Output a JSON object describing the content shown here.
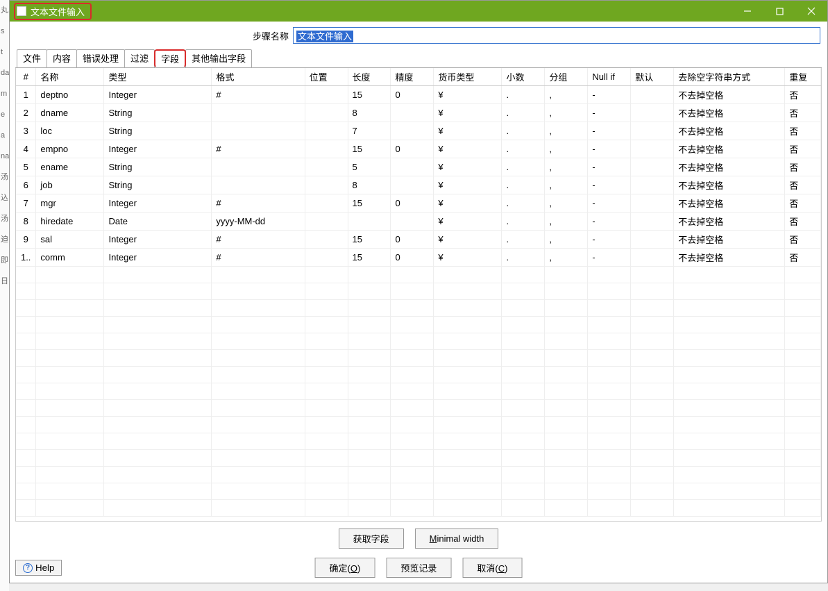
{
  "window": {
    "title": "文本文件输入"
  },
  "step": {
    "label": "步骤名称",
    "value": "文本文件输入"
  },
  "tabs": [
    "文件",
    "内容",
    "错误处理",
    "过滤",
    "字段",
    "其他输出字段"
  ],
  "active_tab_index": 4,
  "highlight_tab_index": 4,
  "columns": [
    "#",
    "名称",
    "类型",
    "格式",
    "位置",
    "长度",
    "精度",
    "货币类型",
    "小数",
    "分组",
    "Null if",
    "默认",
    "去除空字符串方式",
    "重复"
  ],
  "rows": [
    {
      "idx": "1",
      "name": "deptno",
      "type": "Integer",
      "format": "#",
      "pos": "",
      "len": "15",
      "prec": "0",
      "curr": "¥",
      "dec": ".",
      "grp": ",",
      "nullif": "-",
      "def": "",
      "trim": "不去掉空格",
      "rep": "否"
    },
    {
      "idx": "2",
      "name": "dname",
      "type": "String",
      "format": "",
      "pos": "",
      "len": "8",
      "prec": "",
      "curr": "¥",
      "dec": ".",
      "grp": ",",
      "nullif": "-",
      "def": "",
      "trim": "不去掉空格",
      "rep": "否"
    },
    {
      "idx": "3",
      "name": "loc",
      "type": "String",
      "format": "",
      "pos": "",
      "len": "7",
      "prec": "",
      "curr": "¥",
      "dec": ".",
      "grp": ",",
      "nullif": "-",
      "def": "",
      "trim": "不去掉空格",
      "rep": "否"
    },
    {
      "idx": "4",
      "name": "empno",
      "type": "Integer",
      "format": "#",
      "pos": "",
      "len": "15",
      "prec": "0",
      "curr": "¥",
      "dec": ".",
      "grp": ",",
      "nullif": "-",
      "def": "",
      "trim": "不去掉空格",
      "rep": "否"
    },
    {
      "idx": "5",
      "name": "ename",
      "type": "String",
      "format": "",
      "pos": "",
      "len": "5",
      "prec": "",
      "curr": "¥",
      "dec": ".",
      "grp": ",",
      "nullif": "-",
      "def": "",
      "trim": "不去掉空格",
      "rep": "否"
    },
    {
      "idx": "6",
      "name": "job",
      "type": "String",
      "format": "",
      "pos": "",
      "len": "8",
      "prec": "",
      "curr": "¥",
      "dec": ".",
      "grp": ",",
      "nullif": "-",
      "def": "",
      "trim": "不去掉空格",
      "rep": "否"
    },
    {
      "idx": "7",
      "name": "mgr",
      "type": "Integer",
      "format": "#",
      "pos": "",
      "len": "15",
      "prec": "0",
      "curr": "¥",
      "dec": ".",
      "grp": ",",
      "nullif": "-",
      "def": "",
      "trim": "不去掉空格",
      "rep": "否"
    },
    {
      "idx": "8",
      "name": "hiredate",
      "type": "Date",
      "format": "yyyy-MM-dd",
      "pos": "",
      "len": "",
      "prec": "",
      "curr": "¥",
      "dec": ".",
      "grp": ",",
      "nullif": "-",
      "def": "",
      "trim": "不去掉空格",
      "rep": "否"
    },
    {
      "idx": "9",
      "name": "sal",
      "type": "Integer",
      "format": "#",
      "pos": "",
      "len": "15",
      "prec": "0",
      "curr": "¥",
      "dec": ".",
      "grp": ",",
      "nullif": "-",
      "def": "",
      "trim": "不去掉空格",
      "rep": "否"
    },
    {
      "idx": "1..",
      "name": "comm",
      "type": "Integer",
      "format": "#",
      "pos": "",
      "len": "15",
      "prec": "0",
      "curr": "¥",
      "dec": ".",
      "grp": ",",
      "nullif": "-",
      "def": "",
      "trim": "不去掉空格",
      "rep": "否"
    }
  ],
  "buttons": {
    "get_fields": "获取字段",
    "minimal_width_pre": "M",
    "minimal_width_rest": "inimal width",
    "ok_pre": "确定(",
    "ok_mn": "O",
    "ok_post": ")",
    "preview": "预览记录",
    "cancel_pre": "取消(",
    "cancel_mn": "C",
    "cancel_post": ")",
    "help": "Help"
  },
  "left_strip": [
    "丸",
    "",
    "",
    "",
    "",
    "",
    "",
    "",
    "",
    "",
    "",
    "s",
    "t",
    "da",
    "m",
    "e",
    "a",
    "na",
    "",
    "",
    "汤",
    "込",
    "",
    "汤",
    "迫",
    "",
    "即",
    "",
    "",
    "日"
  ]
}
